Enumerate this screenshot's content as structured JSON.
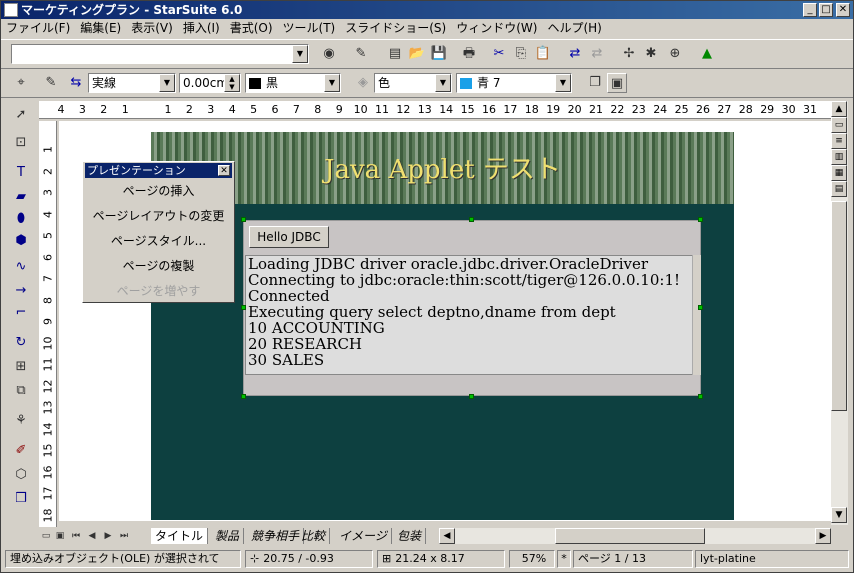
{
  "window": {
    "title": "マーケティングプラン - StarSuite 6.0"
  },
  "menu": [
    "ファイル(F)",
    "編集(E)",
    "表示(V)",
    "挿入(I)",
    "書式(O)",
    "ツール(T)",
    "スライドショー(S)",
    "ウィンドウ(W)",
    "ヘルプ(H)"
  ],
  "toolbar2": {
    "line_style": "実線",
    "line_width": "0.00cm",
    "line_color": "黒",
    "fill_type": "色",
    "fill_color": "青 7"
  },
  "ruler_h": [
    "4",
    "3",
    "2",
    "1",
    "",
    "1",
    "2",
    "3",
    "4",
    "5",
    "6",
    "7",
    "8",
    "9",
    "10",
    "11",
    "12",
    "13",
    "14",
    "15",
    "16",
    "17",
    "18",
    "19",
    "20",
    "21",
    "22",
    "23",
    "24",
    "25",
    "26",
    "27",
    "28",
    "29",
    "30",
    "31"
  ],
  "ruler_v": [
    "1",
    "2",
    "3",
    "4",
    "5",
    "6",
    "7",
    "8",
    "9",
    "10",
    "11",
    "12",
    "13",
    "14",
    "15",
    "16",
    "17",
    "18"
  ],
  "slide": {
    "title": "Java Applet テスト"
  },
  "applet": {
    "button": "Hello JDBC",
    "lines": [
      "Loading JDBC driver oracle.jdbc.driver.OracleDriver",
      "Connecting to jdbc:oracle:thin:scott/tiger@126.0.0.10:1!",
      "Connected",
      "Executing query select  deptno,dname from dept",
      "10 ACCOUNTING",
      "20 RESEARCH",
      "30 SALES"
    ]
  },
  "panel": {
    "title": "プレゼンテーション",
    "items": [
      "ページの挿入",
      "ページレイアウトの変更",
      "ページスタイル...",
      "ページの複製",
      "ページを増やす"
    ]
  },
  "tabs": [
    "タイトル",
    "製品",
    "競争相手",
    "比較",
    "イメージ",
    "包装"
  ],
  "status": {
    "object": "埋め込みオブジェクト(OLE) が選択されて",
    "position": "20.75 / -0.93",
    "size": "21.24 x 8.17",
    "zoom": "57%",
    "modified": "*",
    "page": "ページ 1 / 13",
    "layout": "lyt-platine"
  }
}
